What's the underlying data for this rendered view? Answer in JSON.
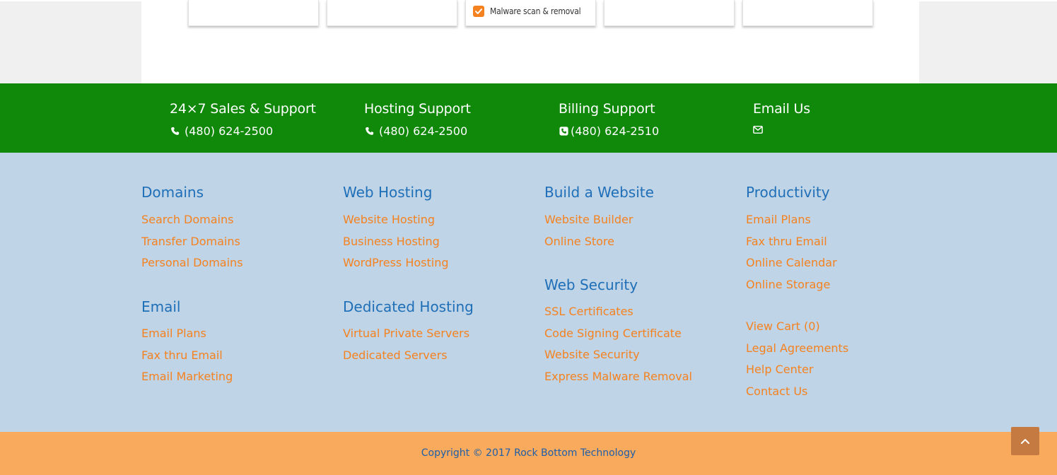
{
  "top_cards": {
    "checked_label": "Malware scan & removal"
  },
  "support": [
    {
      "title": "24×7 Sales & Support",
      "phone": "(480) 624-2500",
      "icon": "phone-icon"
    },
    {
      "title": "Hosting Support",
      "phone": "(480) 624-2500",
      "icon": "phone-icon"
    },
    {
      "title": "Billing Support",
      "phone": "(480) 624-2510",
      "icon": "phone-icon"
    },
    {
      "title": "Email Us",
      "phone": "",
      "icon": "envelope-icon"
    }
  ],
  "footer": {
    "domains": {
      "title": "Domains",
      "links": [
        "Search Domains",
        "Transfer Domains",
        "Personal Domains"
      ]
    },
    "email": {
      "title": "Email",
      "links": [
        "Email Plans",
        "Fax thru Email",
        "Email Marketing"
      ]
    },
    "web_hosting": {
      "title": "Web Hosting",
      "links": [
        "Website Hosting",
        "Business Hosting",
        "WordPress Hosting"
      ]
    },
    "dedicated_hosting": {
      "title": "Dedicated Hosting",
      "links": [
        "Virtual Private Servers",
        "Dedicated Servers"
      ]
    },
    "build_website": {
      "title": "Build a Website",
      "links": [
        "Website Builder",
        "Online Store"
      ]
    },
    "web_security": {
      "title": "Web Security",
      "links": [
        "SSL Certificates",
        "Code Signing Certificate",
        "Website Security",
        "Express Malware Removal"
      ]
    },
    "productivity": {
      "title": "Productivity",
      "links": [
        "Email Plans",
        "Fax thru Email",
        "Online Calendar",
        "Online Storage"
      ]
    },
    "misc": {
      "links": [
        "View Cart (0)",
        "Legal Agreements",
        "Help Center",
        "Contact Us"
      ]
    }
  },
  "copyright": "Copyright © 2017 Rock Bottom Technology",
  "colors": {
    "support_bar": "#108809",
    "footer_bg": "#bfd4e6",
    "link": "#f58220",
    "heading": "#1f6fb8",
    "copyright_bar": "#f9aa5c",
    "scroll_button": "#c47a41"
  }
}
